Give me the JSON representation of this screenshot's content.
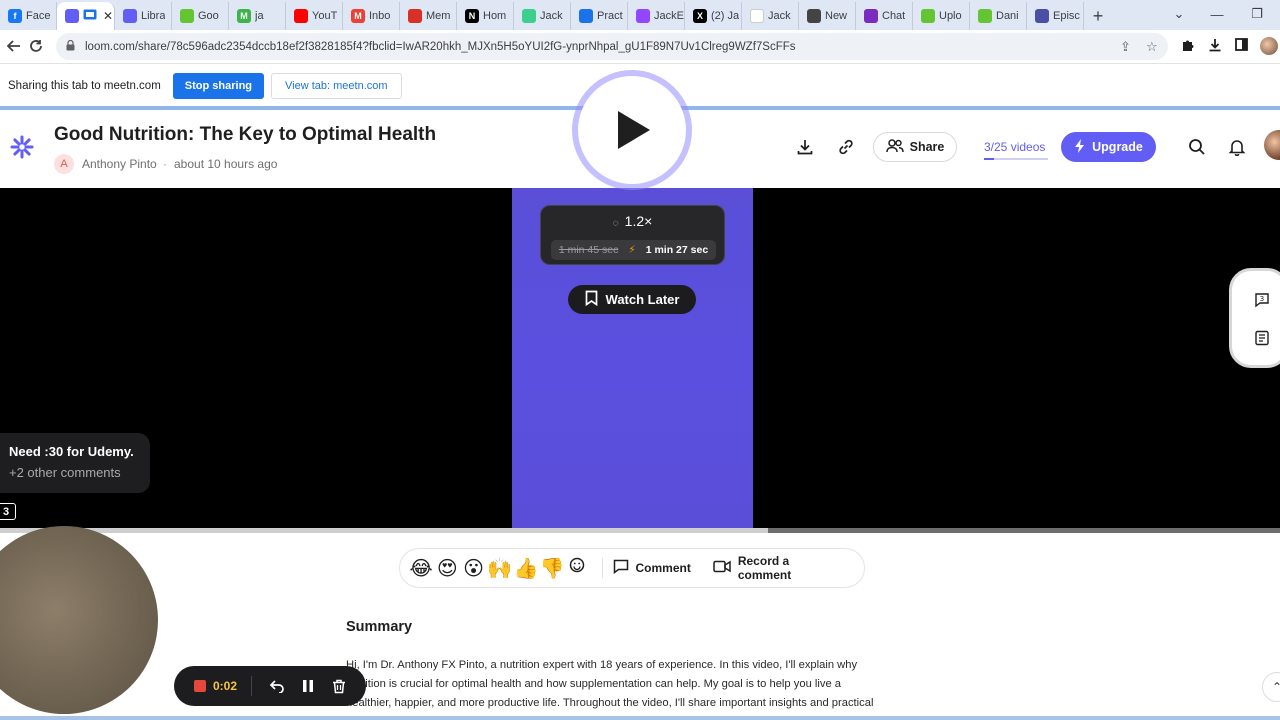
{
  "browser": {
    "tabs": [
      {
        "label": "Face",
        "icon": "facebook-icon",
        "color": "#1877f2",
        "glyph": "f"
      },
      {
        "label": "",
        "icon": "loom-icon",
        "color": "#625df5",
        "glyph": "",
        "active": true
      },
      {
        "label": "Libra",
        "icon": "loom-icon",
        "color": "#625df5",
        "glyph": ""
      },
      {
        "label": "Goo",
        "icon": "green-play-icon",
        "color": "#64c431",
        "glyph": ""
      },
      {
        "label": "ja",
        "icon": "green-m-icon",
        "color": "#3bb54a",
        "glyph": "M"
      },
      {
        "label": "YouT",
        "icon": "youtube-icon",
        "color": "#ff0000",
        "glyph": ""
      },
      {
        "label": "Inbo",
        "icon": "gmail-icon",
        "color": "#ea4335",
        "glyph": "M"
      },
      {
        "label": "Mem",
        "icon": "red-circle-icon",
        "color": "#d93025",
        "glyph": ""
      },
      {
        "label": "Hom",
        "icon": "notion-icon",
        "color": "#000000",
        "glyph": "N"
      },
      {
        "label": "Jack",
        "icon": "star-icon",
        "color": "#3ecf8e",
        "glyph": ""
      },
      {
        "label": "Pract",
        "icon": "blue-circle-icon",
        "color": "#1a73e8",
        "glyph": ""
      },
      {
        "label": "JackE",
        "icon": "twitch-icon",
        "color": "#9146ff",
        "glyph": ""
      },
      {
        "label": "(2) Ja",
        "icon": "x-icon",
        "color": "#000000",
        "glyph": "X"
      },
      {
        "label": "Jack",
        "icon": "blank-icon",
        "color": "#ffffff",
        "glyph": ""
      },
      {
        "label": "New",
        "icon": "openai-icon",
        "color": "#444444",
        "glyph": ""
      },
      {
        "label": "Chat",
        "icon": "purple-circle-icon",
        "color": "#7b2cbf",
        "glyph": ""
      },
      {
        "label": "Uplo",
        "icon": "green-play-icon",
        "color": "#64c431",
        "glyph": ""
      },
      {
        "label": "Dani",
        "icon": "green-play-icon",
        "color": "#64c431",
        "glyph": ""
      },
      {
        "label": "Episc",
        "icon": "globe-icon",
        "color": "#4b4fa6",
        "glyph": ""
      }
    ],
    "url": "loom.com/share/78c596adc2354dccb18ef2f3828185f4?fbclid=IwAR20hkh_MJXn5H5oYUI2fG-ynprNhpal_gU1F89N7Uv1Clreg9WZf7ScFFs"
  },
  "sharing": {
    "text": "Sharing this tab to meetn.com",
    "stop_label": "Stop sharing",
    "view_label": "View tab: meetn.com"
  },
  "video": {
    "title": "Good Nutrition: The Key to Optimal Health",
    "author_initial": "A",
    "author": "Anthony Pinto",
    "separator": "·",
    "posted": "about 10 hours ago",
    "share_label": "Share",
    "video_count": "3/25 videos",
    "upgrade_label": "Upgrade",
    "speed": "1.2×",
    "original_duration": "1 min 45 sec",
    "fast_duration": "1 min 27 sec",
    "watch_later_label": "Watch Later",
    "comment_preview": "Need :30 for Udemy.",
    "other_comments": "+2 other comments",
    "marker_count": "3",
    "progress_fraction": 0.6
  },
  "reactions": {
    "emojis": [
      "😂",
      "😍",
      "😮",
      "🙌",
      "👍",
      "👎"
    ],
    "comment_label": "Comment",
    "record_label": "Record a comment"
  },
  "summary": {
    "title": "Summary",
    "text": "Hi, I'm Dr. Anthony FX Pinto, a nutrition expert with 18 years of experience. In this video, I'll explain why nutrition is crucial for optimal health and how supplementation can help. My goal is to help you live a healthier, happier, and more productive life. Throughout the video, I'll share important insights and practical tips. I encourage you to provide feedback as we go along. Let's get started!"
  },
  "recorder": {
    "time": "0:02",
    "stop_color": "#e5483b"
  },
  "colors": {
    "accent": "#625df5",
    "chrome_blue": "#1a73e8"
  }
}
